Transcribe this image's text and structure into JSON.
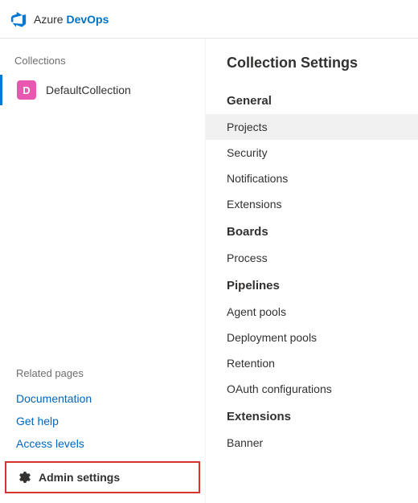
{
  "header": {
    "brand1": "Azure",
    "brand2": "DevOps"
  },
  "sidebar": {
    "collections_label": "Collections",
    "collection": {
      "initial": "D",
      "name": "DefaultCollection"
    },
    "related_label": "Related pages",
    "related_links": {
      "documentation": "Documentation",
      "get_help": "Get help",
      "access_levels": "Access levels"
    },
    "admin_settings_label": "Admin settings"
  },
  "main": {
    "title": "Collection Settings",
    "groups": {
      "general": {
        "header": "General",
        "items": {
          "projects": "Projects",
          "security": "Security",
          "notifications": "Notifications",
          "extensions": "Extensions"
        }
      },
      "boards": {
        "header": "Boards",
        "items": {
          "process": "Process"
        }
      },
      "pipelines": {
        "header": "Pipelines",
        "items": {
          "agent_pools": "Agent pools",
          "deployment_pools": "Deployment pools",
          "retention": "Retention",
          "oauth": "OAuth configurations"
        }
      },
      "extensions": {
        "header": "Extensions",
        "items": {
          "banner": "Banner"
        }
      }
    }
  }
}
